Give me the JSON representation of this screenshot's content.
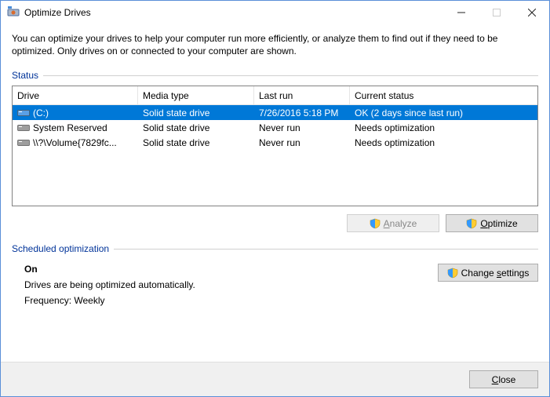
{
  "window": {
    "title": "Optimize Drives"
  },
  "intro": "You can optimize your drives to help your computer run more efficiently, or analyze them to find out if they need to be optimized. Only drives on or connected to your computer are shown.",
  "status": {
    "label": "Status",
    "columns": {
      "drive": "Drive",
      "media": "Media type",
      "last": "Last run",
      "status": "Current status"
    },
    "rows": [
      {
        "drive": "(C:)",
        "media": "Solid state drive",
        "last": "7/26/2016 5:18 PM",
        "status": "OK (2 days since last run)",
        "selected": true,
        "iconColor": "blue"
      },
      {
        "drive": "System Reserved",
        "media": "Solid state drive",
        "last": "Never run",
        "status": "Needs optimization",
        "selected": false,
        "iconColor": "gray"
      },
      {
        "drive": "\\\\?\\Volume{7829fc...",
        "media": "Solid state drive",
        "last": "Never run",
        "status": "Needs optimization",
        "selected": false,
        "iconColor": "gray"
      }
    ]
  },
  "buttons": {
    "analyze_prefix": "A",
    "analyze_rest": "nalyze",
    "optimize_prefix": "O",
    "optimize_rest": "ptimize",
    "change_prefix": "Change ",
    "change_u": "s",
    "change_rest": "ettings",
    "close_prefix": "C",
    "close_rest": "lose"
  },
  "schedule": {
    "label": "Scheduled optimization",
    "state": "On",
    "desc": "Drives are being optimized automatically.",
    "freq": "Frequency: Weekly"
  }
}
